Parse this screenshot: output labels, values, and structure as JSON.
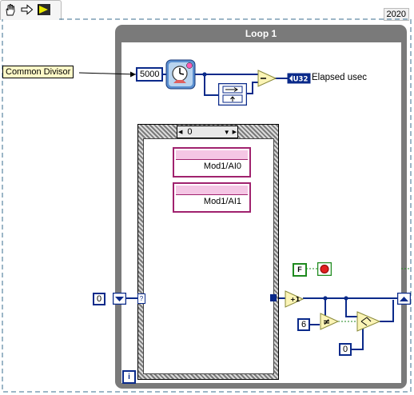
{
  "toolbar": {
    "hand_icon": "hand-icon",
    "arrow_icon": "arrow-right-icon",
    "flag_icon": "flag-icon"
  },
  "version": "2020",
  "timed_loop": {
    "title": "Loop 1"
  },
  "labels": {
    "common_divisor": "Common Divisor",
    "elapsed_usec": "Elapsed usec"
  },
  "constants": {
    "divisor": "5000",
    "iteration_init": "0",
    "compare_value": "6",
    "false_const": "F",
    "select_zero": "0"
  },
  "indicator": {
    "type": "U32"
  },
  "case_structure": {
    "selector_value": "0",
    "channels": [
      "Mod1/AI0",
      "Mod1/AI1"
    ]
  },
  "iteration_terminal": "i",
  "colors": {
    "wire_blue": "#0a2a8a",
    "loop_gray": "#7a7a7a",
    "dash_border": "#3a6e8f",
    "bool_green": "#1e8a1e",
    "stop_red": "#e02020"
  }
}
